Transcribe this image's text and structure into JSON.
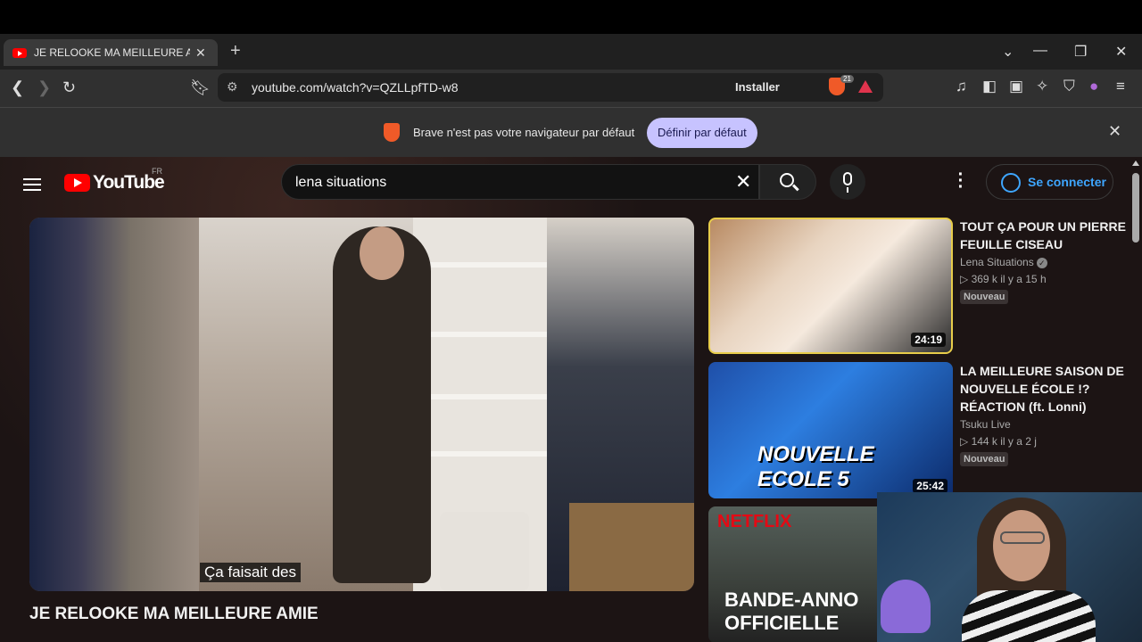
{
  "browser": {
    "tab_title": "JE RELOOKE MA MEILLEURE AMIE",
    "url": "youtube.com/watch?v=QZLLpfTD-w8",
    "install_label": "Installer",
    "shield_count": "21",
    "infobar_message": "Brave n'est pas votre navigateur par défaut",
    "infobar_button": "Définir par défaut"
  },
  "youtube": {
    "logo_word": "YouTube",
    "region": "FR",
    "search_query": "lena situations",
    "signin_label": "Se connecter",
    "caption": "Ça faisait des",
    "video_title": "JE RELOOKE MA MEILLEURE AMIE",
    "recommendations": [
      {
        "title": "TOUT ÇA POUR UN PIERRE FEUILLE CISEAU",
        "channel": "Lena Situations",
        "meta": "▷ 369 k  il y a 15 h",
        "badge": "Nouveau",
        "duration": "24:19"
      },
      {
        "title": "LA MEILLEURE SAISON DE NOUVELLE ÉCOLE !? RÉACTION (ft. Lonni)",
        "channel": "Tsuku Live",
        "meta": "▷ 144 k  il y a 2 j",
        "badge": "Nouveau",
        "duration": "25:42"
      },
      {
        "thumb_brand": "NETFLIX",
        "thumb_text": "BANDE-ANNO OFFICIELLE"
      }
    ],
    "thumb2_text": "NOUVELLE ECOLE 5"
  },
  "colors": {
    "accent": "#3ea6ff",
    "brand": "#ff0000",
    "brave": "#f05a28"
  }
}
